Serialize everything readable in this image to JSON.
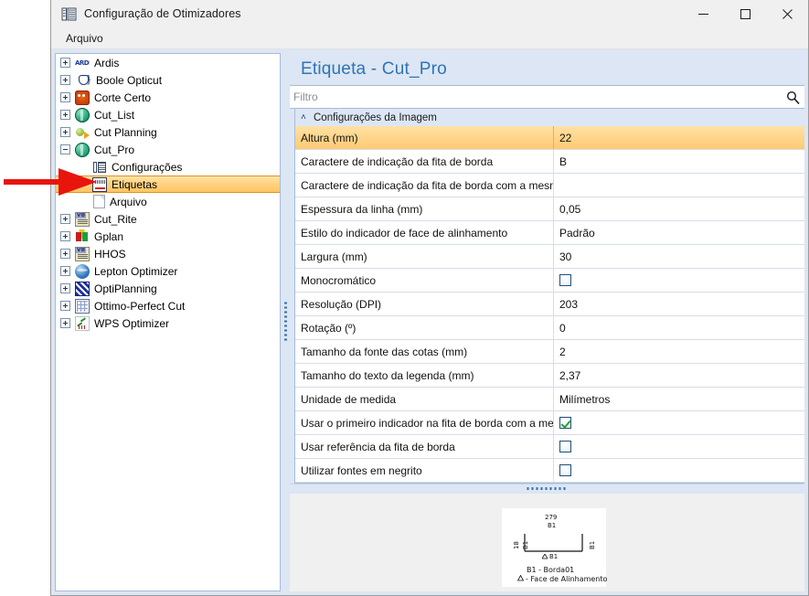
{
  "window": {
    "title": "Configuração de Otimizadores",
    "title_icon": "settings-grid-icon",
    "minimize_label": "—",
    "maximize_label": "□",
    "close_label": "✕"
  },
  "menu": {
    "items": [
      {
        "label": "Arquivo"
      }
    ]
  },
  "sidebar": {
    "items": [
      {
        "label": "Ardis",
        "icon": "ardis-icon",
        "expander": "plus",
        "depth": 0
      },
      {
        "label": "Boole Opticut",
        "icon": "boole-icon",
        "expander": "plus",
        "depth": 0
      },
      {
        "label": "Corte Certo",
        "icon": "corte-icon",
        "expander": "plus",
        "depth": 0
      },
      {
        "label": "Cut_List",
        "icon": "cut-icon",
        "expander": "plus",
        "depth": 0
      },
      {
        "label": "Cut Planning",
        "icon": "planning-icon",
        "expander": "plus",
        "depth": 0
      },
      {
        "label": "Cut_Pro",
        "icon": "cut-icon",
        "expander": "minus",
        "depth": 0
      },
      {
        "label": "Configurações",
        "icon": "config-icon",
        "expander": "none",
        "depth": 1
      },
      {
        "label": "Etiquetas",
        "icon": "etiqueta-icon",
        "expander": "none",
        "depth": 1,
        "selected": true
      },
      {
        "label": "Arquivo",
        "icon": "file-icon",
        "expander": "none",
        "depth": 1
      },
      {
        "label": "Cut_Rite",
        "icon": "vb-icon",
        "expander": "plus",
        "depth": 0
      },
      {
        "label": "Gplan",
        "icon": "gplan-icon",
        "expander": "plus",
        "depth": 0
      },
      {
        "label": "HHOS",
        "icon": "vb-icon",
        "expander": "plus",
        "depth": 0
      },
      {
        "label": "Lepton Optimizer",
        "icon": "lepton-icon",
        "expander": "plus",
        "depth": 0
      },
      {
        "label": "OptiPlanning",
        "icon": "opti-icon",
        "expander": "plus",
        "depth": 0
      },
      {
        "label": "Ottimo-Perfect Cut",
        "icon": "ottimo-icon",
        "expander": "plus",
        "depth": 0
      },
      {
        "label": "WPS Optimizer",
        "icon": "wps-icon",
        "expander": "plus",
        "depth": 0
      }
    ]
  },
  "main": {
    "heading": "Etiqueta - Cut_Pro",
    "filter": {
      "value": "",
      "placeholder": "Filtro",
      "icon": "search-icon"
    },
    "category": {
      "label": "Configurações da Imagem",
      "caret": "˄"
    },
    "properties": [
      {
        "name": "Altura (mm)",
        "value": "22",
        "type": "text",
        "selected": true
      },
      {
        "name": "Caractere de indicação da fita de borda",
        "value": "B",
        "type": "text"
      },
      {
        "name": "Caractere de indicação da fita de borda com a mesm...",
        "value": "",
        "type": "text"
      },
      {
        "name": "Espessura da linha (mm)",
        "value": "0,05",
        "type": "text"
      },
      {
        "name": "Estilo do indicador de face de alinhamento",
        "value": "Padrão",
        "type": "text"
      },
      {
        "name": "Largura (mm)",
        "value": "30",
        "type": "text"
      },
      {
        "name": "Monocromático",
        "value": "",
        "type": "checkbox",
        "checked": false
      },
      {
        "name": "Resolução (DPI)",
        "value": "203",
        "type": "text"
      },
      {
        "name": "Rotação (º)",
        "value": "0",
        "type": "text"
      },
      {
        "name": "Tamanho da fonte das cotas (mm)",
        "value": "2",
        "type": "text"
      },
      {
        "name": "Tamanho do texto da legenda (mm)",
        "value": "2,37",
        "type": "text"
      },
      {
        "name": "Unidade de medida",
        "value": "Milímetros",
        "type": "text"
      },
      {
        "name": "Usar o primeiro indicador na fita de borda com a me...",
        "value": "",
        "type": "checkbox",
        "checked": true
      },
      {
        "name": "Usar referência da fita de borda",
        "value": "",
        "type": "checkbox",
        "checked": false
      },
      {
        "name": "Utilizar fontes em negrito",
        "value": "",
        "type": "checkbox",
        "checked": false
      }
    ]
  },
  "preview": {
    "top_value": "279",
    "top_edge": "B1",
    "bottom_edge": "B1",
    "left_value_outer": "18",
    "left_value_inner": "B1",
    "right_value": "B1",
    "legend_line1": "B1 - Borda01",
    "legend_line2": "- Face de Alinhamento"
  },
  "annotation": {
    "arrow_color": "#e8150f",
    "points_at": "Etiquetas"
  },
  "colors": {
    "accent_blue": "#2e74b5",
    "panel_blue": "#dce6f4",
    "selection_orange": "#ffd489",
    "selection_border": "#e09020",
    "checkbox_border": "#1f4e79",
    "check_green": "#2aa02a"
  }
}
